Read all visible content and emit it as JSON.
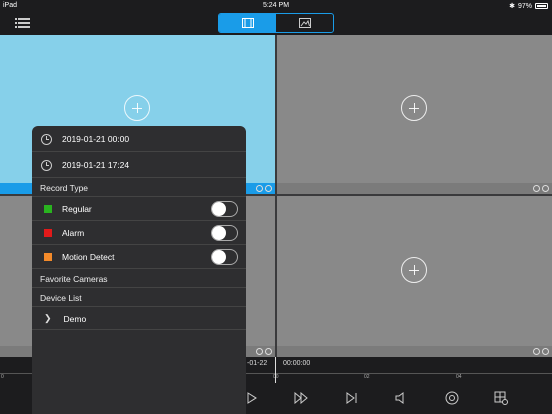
{
  "status_bar": {
    "carrier": "iPad",
    "time": "5:24 PM",
    "battery": "97%"
  },
  "icons": {
    "menu": "list-menu-icon",
    "playback_tab": "film-icon",
    "picture_tab": "image-icon",
    "add": "plus-circle-icon",
    "zoom": "zoom-in-icon",
    "record": "circle-icon",
    "clock": "clock-icon",
    "chevron": "chevron-right-icon"
  },
  "colors": {
    "accent": "#1a9ce8",
    "regular": "#29b31f",
    "alarm": "#e21a1a",
    "motion_detect": "#f38a2a"
  },
  "popover": {
    "start_time": "2019-01-21 00:00",
    "end_time": "2019-01-21 17:24",
    "record_type_header": "Record Type",
    "record_types": [
      {
        "label": "Regular",
        "enabled": false
      },
      {
        "label": "Alarm",
        "enabled": false
      },
      {
        "label": "Motion Detect",
        "enabled": false
      }
    ],
    "favorite_cameras_header": "Favorite Cameras",
    "device_list_header": "Device List",
    "devices": [
      {
        "label": "Demo"
      }
    ]
  },
  "timeline": {
    "date_fragment": "-01-22",
    "current_time": "00:00:00",
    "ticks": [
      "0",
      "00",
      "02",
      "04"
    ]
  },
  "toolbar": {
    "play": "play-icon",
    "fast_forward": "fast-forward-icon",
    "next_frame": "skip-forward-icon",
    "audio": "speaker-icon",
    "snapshot": "camera-icon",
    "layout": "grid-layout-icon"
  }
}
